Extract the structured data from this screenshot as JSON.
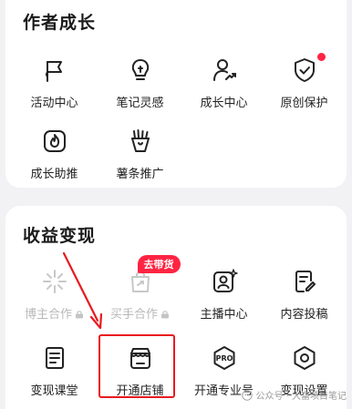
{
  "growth": {
    "title": "作者成长",
    "items": [
      {
        "label": "活动中心",
        "icon": "flag-icon"
      },
      {
        "label": "笔记灵感",
        "icon": "lightbulb-icon"
      },
      {
        "label": "成长中心",
        "icon": "user-growth-icon"
      },
      {
        "label": "原创保护",
        "icon": "shield-check-icon"
      },
      {
        "label": "成长助推",
        "icon": "fire-boost-icon"
      },
      {
        "label": "薯条推广",
        "icon": "fries-icon"
      }
    ]
  },
  "revenue": {
    "title": "收益变现",
    "items": [
      {
        "label": "博主合作",
        "icon": "sparkle-icon"
      },
      {
        "label": "买手合作",
        "icon": "shopping-bag-icon",
        "badge": "去带货"
      },
      {
        "label": "主播中心",
        "icon": "anchor-portrait-icon"
      },
      {
        "label": "内容投稿",
        "icon": "document-edit-icon"
      },
      {
        "label": "变现课堂",
        "icon": "course-book-icon"
      },
      {
        "label": "开通店铺",
        "icon": "store-icon"
      },
      {
        "label": "开通专业号",
        "icon": "pro-badge-icon",
        "icon_text": "PRO"
      },
      {
        "label": "变现设置",
        "icon": "gear-icon"
      }
    ]
  },
  "watermark": "公众号 · 大富项目笔记",
  "colors": {
    "accent": "#ff2442",
    "highlight": "#e8191f"
  }
}
